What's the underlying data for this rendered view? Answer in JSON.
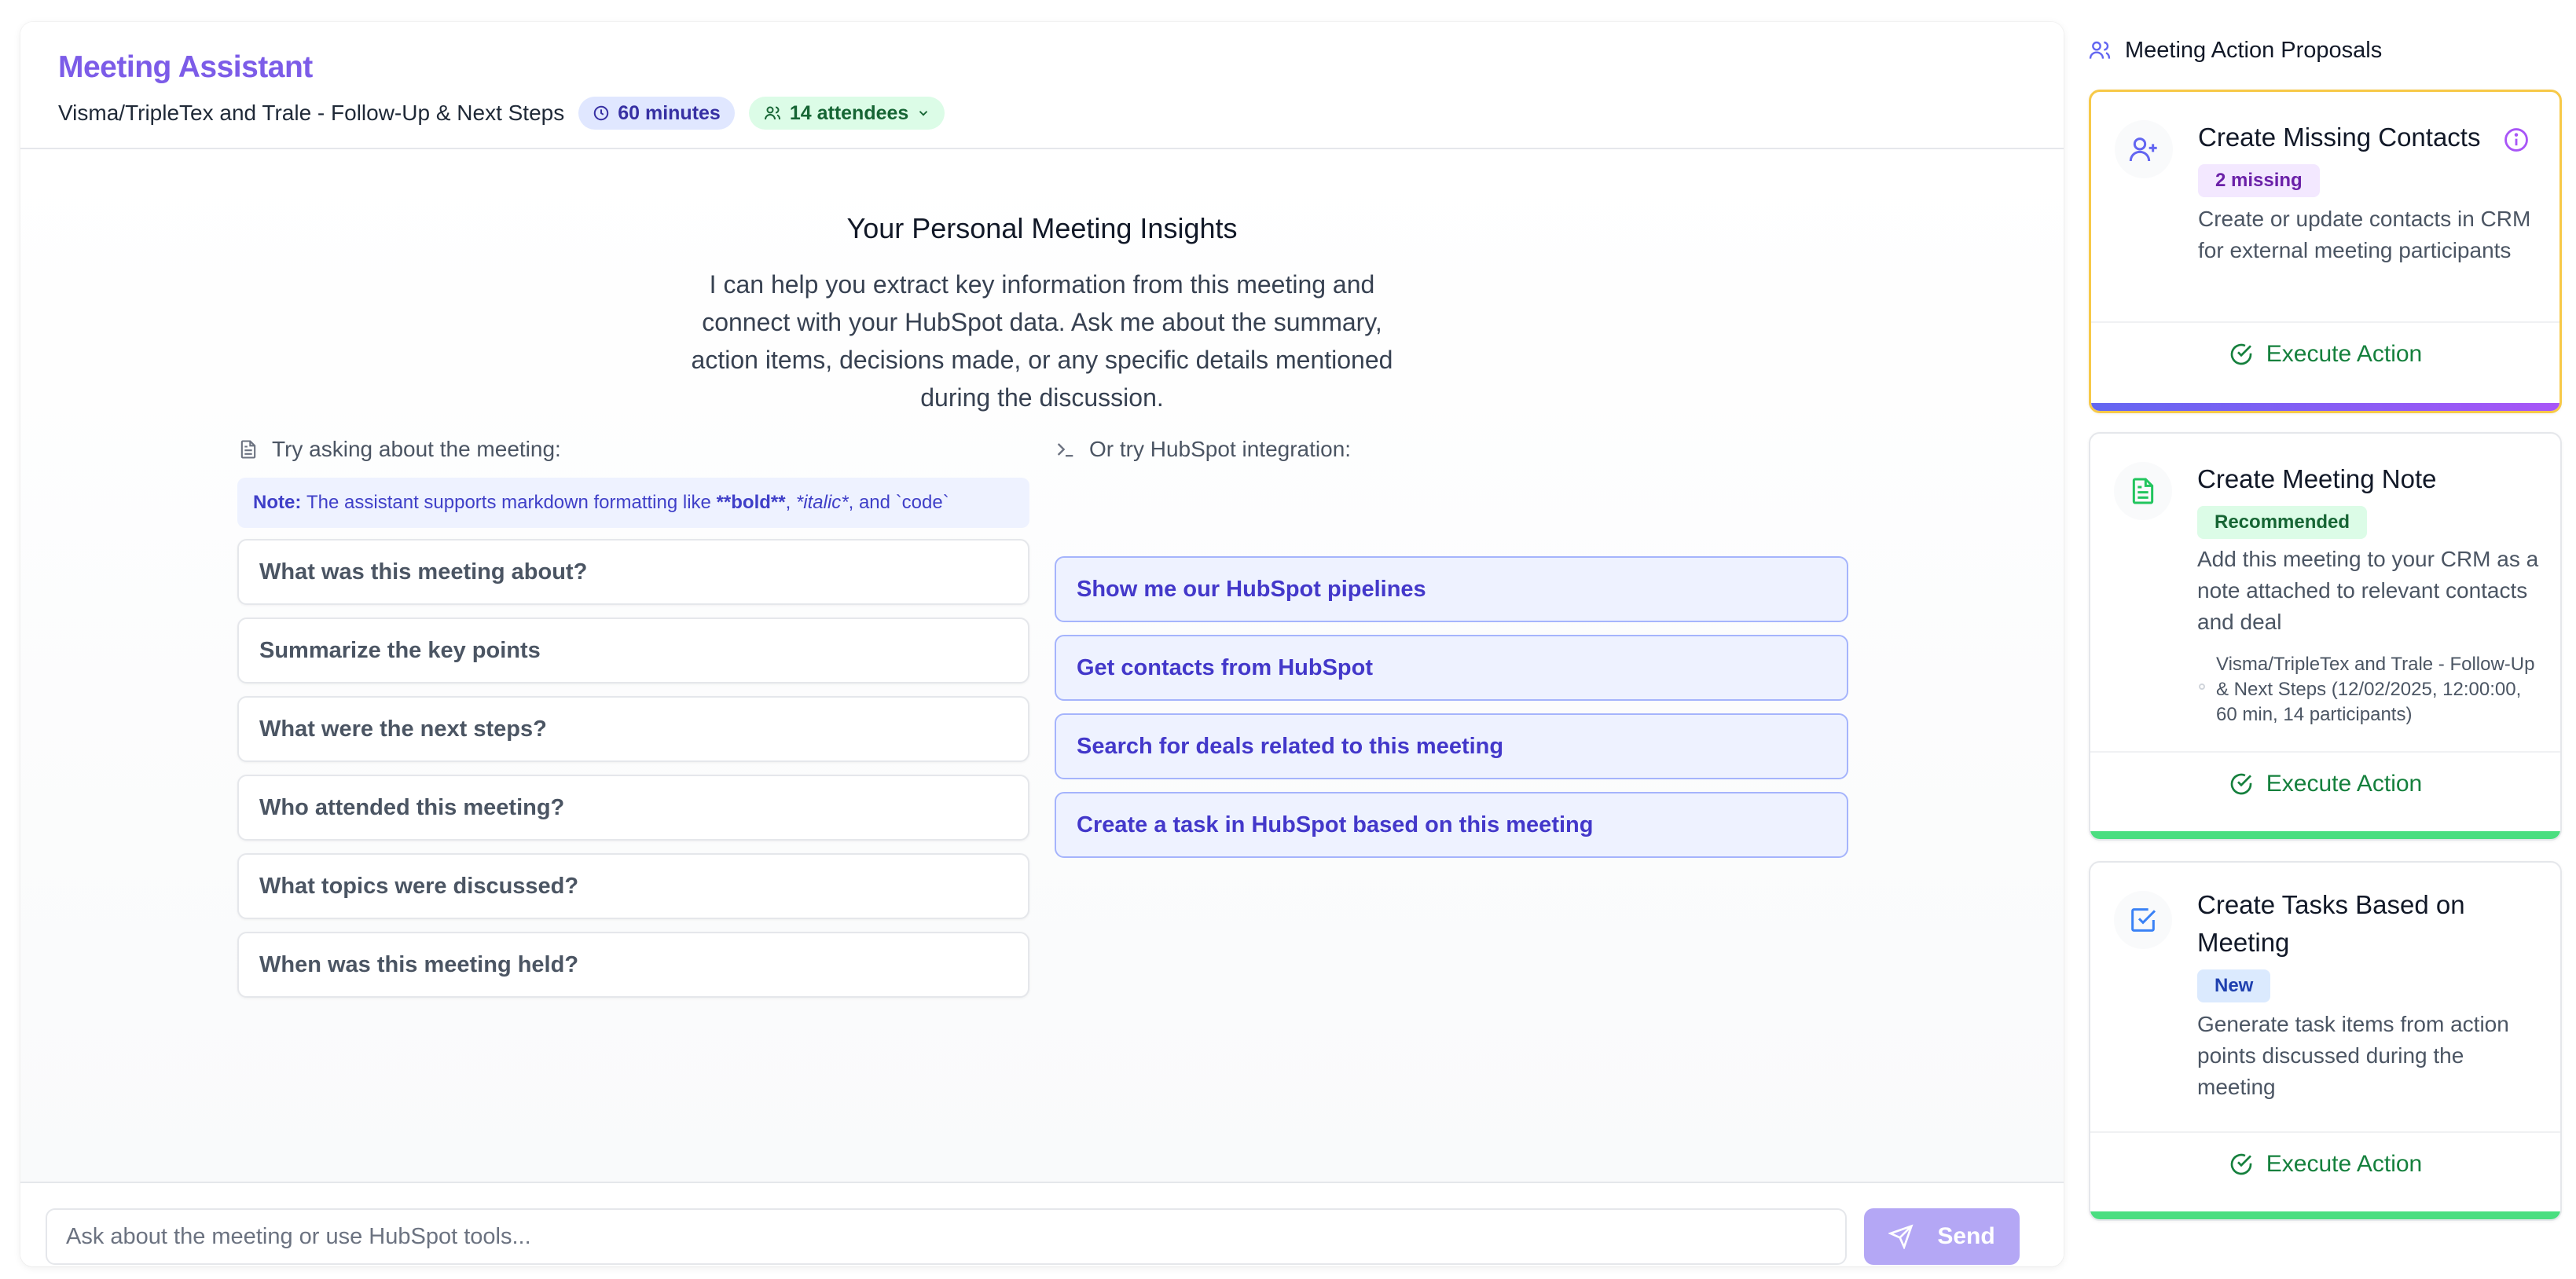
{
  "header": {
    "app_title": "Meeting Assistant",
    "meeting_title": "Visma/TripleTex and Trale - Follow-Up & Next Steps",
    "duration": "60 minutes",
    "attendees": "14 attendees"
  },
  "insights": {
    "title": "Your Personal Meeting Insights",
    "description": "I can help you extract key information from this meeting and connect with your HubSpot data. Ask me about the summary, action items, decisions made, or any specific details mentioned during the discussion."
  },
  "suggestions": {
    "meeting_heading": "Try asking about the meeting:",
    "hubspot_heading": "Or try HubSpot integration:",
    "note": {
      "label": "Note:",
      "text": "The assistant supports markdown formatting like",
      "bold": "**bold**",
      "sep1": ",",
      "italic": "*italic*",
      "sep2": ", and",
      "code": "`code`"
    },
    "meeting_questions": [
      "What was this meeting about?",
      "Summarize the key points",
      "What were the next steps?",
      "Who attended this meeting?",
      "What topics were discussed?",
      "When was this meeting held?"
    ],
    "hubspot_questions": [
      "Show me our HubSpot pipelines",
      "Get contacts from HubSpot",
      "Search for deals related to this meeting",
      "Create a task in HubSpot based on this meeting"
    ]
  },
  "chat": {
    "placeholder": "Ask about the meeting or use HubSpot tools...",
    "send_label": "Send"
  },
  "sidebar": {
    "heading": "Meeting Action Proposals",
    "cards": [
      {
        "title": "Create Missing Contacts",
        "badge": "2 missing",
        "description": "Create or update contacts in CRM for external meeting participants",
        "action": "Execute Action"
      },
      {
        "title": "Create Meeting Note",
        "badge": "Recommended",
        "description": "Add this meeting to your CRM as a note attached to relevant contacts and deal",
        "detail": "Visma/TripleTex and Trale - Follow-Up & Next Steps (12/02/2025, 12:00:00, 60 min, 14 participants)",
        "action": "Execute Action"
      },
      {
        "title": "Create Tasks Based on Meeting",
        "badge": "New",
        "description": "Generate task items from action points discussed during the meeting",
        "action": "Execute Action"
      }
    ]
  },
  "colors": {
    "accent": "#7c5ce8",
    "hubspot_text": "#4338ca",
    "execute_green": "#15803d",
    "selected_border": "#f7c948"
  }
}
